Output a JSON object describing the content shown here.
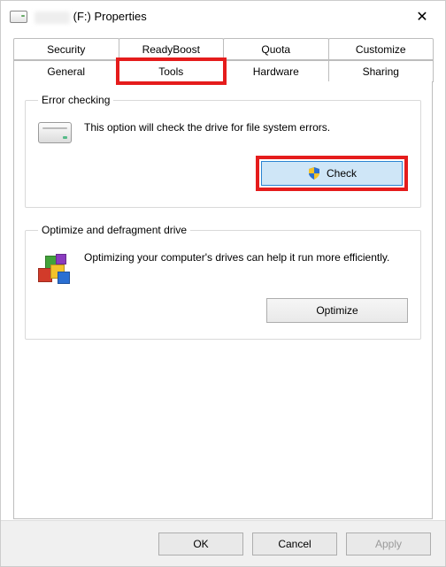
{
  "title": {
    "suffix": "(F:) Properties"
  },
  "tabs": {
    "row1": [
      "Security",
      "ReadyBoost",
      "Quota",
      "Customize"
    ],
    "row2": [
      "General",
      "Tools",
      "Hardware",
      "Sharing"
    ],
    "active": "Tools"
  },
  "errorCheck": {
    "legend": "Error checking",
    "text": "This option will check the drive for file system errors.",
    "button": "Check"
  },
  "optimize": {
    "legend": "Optimize and defragment drive",
    "text": "Optimizing your computer's drives can help it run more efficiently.",
    "button": "Optimize"
  },
  "footer": {
    "ok": "OK",
    "cancel": "Cancel",
    "apply": "Apply"
  }
}
